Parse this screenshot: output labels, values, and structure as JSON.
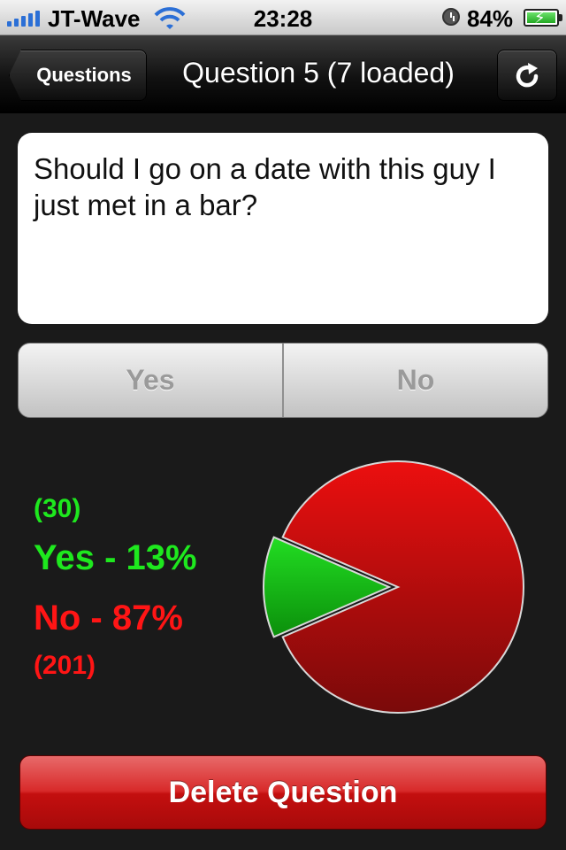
{
  "status_bar": {
    "carrier": "JT-Wave",
    "time": "23:28",
    "battery_percent": "84%",
    "signal_icon": "signal-bars-icon",
    "wifi_icon": "wifi-icon",
    "alarm_icon": "clock-icon",
    "battery_icon": "battery-charging-icon"
  },
  "nav": {
    "back_label": "Questions",
    "title": "Question 5 (7 loaded)",
    "refresh_icon": "refresh-icon"
  },
  "question": {
    "text": "Should I go on a date with this guy I just met in a bar?"
  },
  "answer_control": {
    "options": [
      "Yes",
      "No"
    ]
  },
  "results": {
    "yes_count": "(30)",
    "yes_label": "Yes - 13%",
    "no_label": "No - 87%",
    "no_count": "(201)"
  },
  "chart_data": {
    "type": "pie",
    "categories": [
      "Yes",
      "No"
    ],
    "values": [
      30,
      201
    ],
    "colors": [
      "#1ec81e",
      "#d81010"
    ]
  },
  "actions": {
    "delete_label": "Delete Question"
  },
  "colors": {
    "yes": "#1ee81e",
    "no": "#ff1515",
    "delete_button": "#c40f0f",
    "background": "#1a1a1a"
  }
}
